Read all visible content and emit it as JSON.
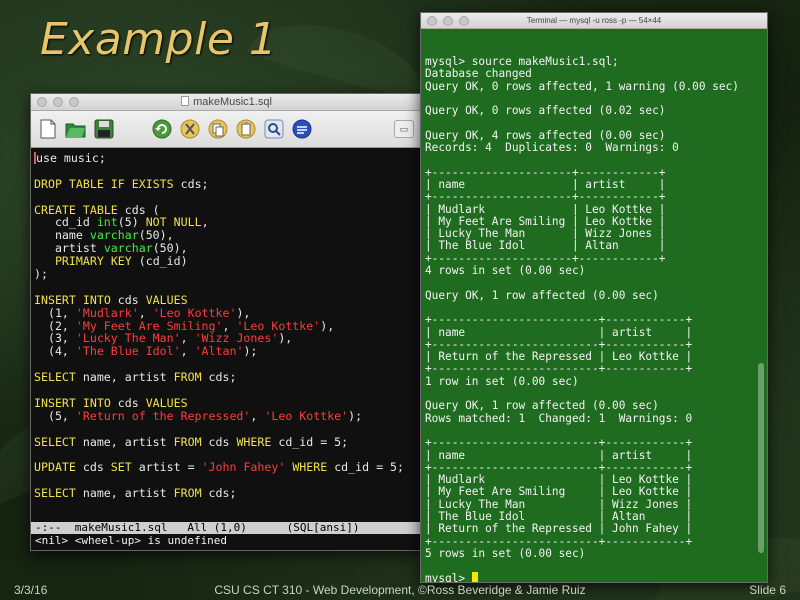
{
  "slide": {
    "title": "Example 1",
    "date": "3/3/16",
    "credit": "CSU CS CT 310 - Web Development, ©Ross Beveridge & Jamie Ruiz",
    "number": "Slide 6"
  },
  "emacs": {
    "title": "makeMusic1.sql",
    "toolbar_icons": [
      "new-file-icon",
      "open-folder-icon",
      "save-icon",
      "undo-icon",
      "cut-icon",
      "copy-icon",
      "paste-icon",
      "search-icon",
      "preferences-icon",
      "info-icon"
    ],
    "code_lines": [
      "use music;",
      "",
      "DROP TABLE IF EXISTS cds;",
      "",
      "CREATE TABLE cds (",
      "   cd_id int(5) NOT NULL,",
      "   name varchar(50),",
      "   artist varchar(50),",
      "   PRIMARY KEY (cd_id)",
      ");",
      "",
      "INSERT INTO cds VALUES",
      "  (1, 'Mudlark', 'Leo Kottke'),",
      "  (2, 'My Feet Are Smiling', 'Leo Kottke'),",
      "  (3, 'Lucky The Man', 'Wizz Jones'),",
      "  (4, 'The Blue Idol', 'Altan');",
      "",
      "SELECT name, artist FROM cds;",
      "",
      "INSERT INTO cds VALUES",
      "  (5, 'Return of the Repressed', 'Leo Kottke');",
      "",
      "SELECT name, artist FROM cds WHERE cd_id = 5;",
      "",
      "UPDATE cds SET artist = 'John Fahey' WHERE cd_id = 5;",
      "",
      "SELECT name, artist FROM cds;",
      "",
      ""
    ],
    "modeline": "-:--  makeMusic1.sql   All (1,0)      (SQL[ansi])",
    "minibuffer": "<nil> <wheel-up> is undefined"
  },
  "terminal": {
    "title": "Terminal — mysql -u ross -p — 54×44",
    "lines": [
      "mysql> source makeMusic1.sql;",
      "Database changed",
      "Query OK, 0 rows affected, 1 warning (0.00 sec)",
      "",
      "Query OK, 0 rows affected (0.02 sec)",
      "",
      "Query OK, 4 rows affected (0.00 sec)",
      "Records: 4  Duplicates: 0  Warnings: 0",
      "",
      "+---------------------+------------+",
      "| name                | artist     |",
      "+---------------------+------------+",
      "| Mudlark             | Leo Kottke |",
      "| My Feet Are Smiling | Leo Kottke |",
      "| Lucky The Man       | Wizz Jones |",
      "| The Blue Idol       | Altan      |",
      "+---------------------+------------+",
      "4 rows in set (0.00 sec)",
      "",
      "Query OK, 1 row affected (0.00 sec)",
      "",
      "+-------------------------+------------+",
      "| name                    | artist     |",
      "+-------------------------+------------+",
      "| Return of the Repressed | Leo Kottke |",
      "+-------------------------+------------+",
      "1 row in set (0.00 sec)",
      "",
      "Query OK, 1 row affected (0.00 sec)",
      "Rows matched: 1  Changed: 1  Warnings: 0",
      "",
      "+-------------------------+------------+",
      "| name                    | artist     |",
      "+-------------------------+------------+",
      "| Mudlark                 | Leo Kottke |",
      "| My Feet Are Smiling     | Leo Kottke |",
      "| Lucky The Man           | Wizz Jones |",
      "| The Blue Idol           | Altan      |",
      "| Return of the Repressed | John Fahey |",
      "+-------------------------+------------+",
      "5 rows in set (0.00 sec)",
      "",
      "mysql> "
    ]
  },
  "colors": {
    "title_gold": "#e8c46a",
    "terminal_bg": "#1f6b1f",
    "emacs_bg": "#101010",
    "sql_keyword": "#f0e04a",
    "sql_type": "#47e747",
    "sql_string": "#ff3b3b"
  }
}
